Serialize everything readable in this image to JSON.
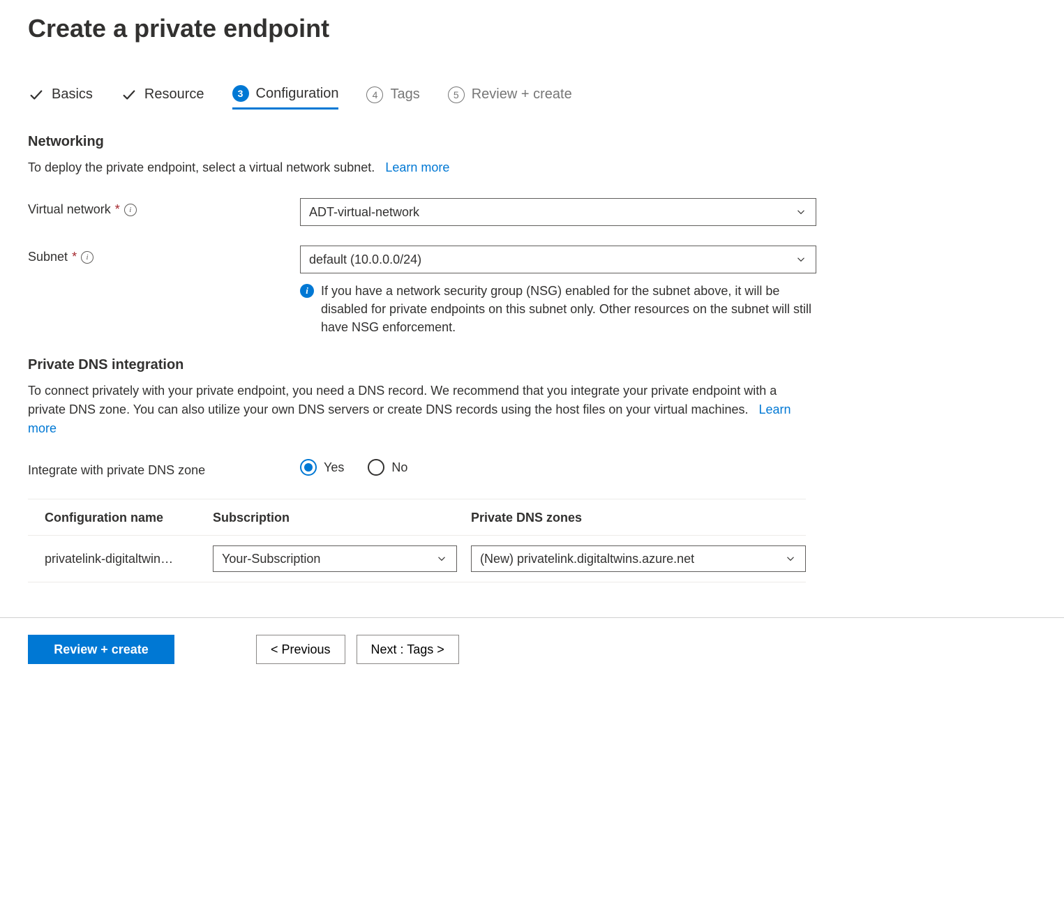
{
  "page_title": "Create a private endpoint",
  "steps": [
    {
      "label": "Basics",
      "state": "completed"
    },
    {
      "label": "Resource",
      "state": "completed"
    },
    {
      "label": "Configuration",
      "state": "active",
      "num": "3"
    },
    {
      "label": "Tags",
      "state": "upcoming",
      "num": "4"
    },
    {
      "label": "Review + create",
      "state": "upcoming",
      "num": "5"
    }
  ],
  "sections": {
    "networking": {
      "heading": "Networking",
      "desc": "To deploy the private endpoint, select a virtual network subnet.",
      "learn_more": "Learn more",
      "virtual_network_label": "Virtual network",
      "virtual_network_value": "ADT-virtual-network",
      "subnet_label": "Subnet",
      "subnet_value": "default (10.0.0.0/24)",
      "subnet_note": "If you have a network security group (NSG) enabled for the subnet above, it will be disabled for private endpoints on this subnet only. Other resources on the subnet will still have NSG enforcement."
    },
    "dns": {
      "heading": "Private DNS integration",
      "desc": "To connect privately with your private endpoint, you need a DNS record. We recommend that you integrate your private endpoint with a private DNS zone. You can also utilize your own DNS servers or create DNS records using the host files on your virtual machines.",
      "learn_more": "Learn more",
      "integrate_label": "Integrate with private DNS zone",
      "yes_label": "Yes",
      "no_label": "No",
      "table": {
        "col_config": "Configuration name",
        "col_sub": "Subscription",
        "col_zone": "Private DNS zones",
        "rows": [
          {
            "config": "privatelink-digitaltwin…",
            "subscription": "Your-Subscription",
            "zone": "(New) privatelink.digitaltwins.azure.net"
          }
        ]
      }
    }
  },
  "footer": {
    "review": "Review + create",
    "previous": "< Previous",
    "next": "Next : Tags >"
  }
}
